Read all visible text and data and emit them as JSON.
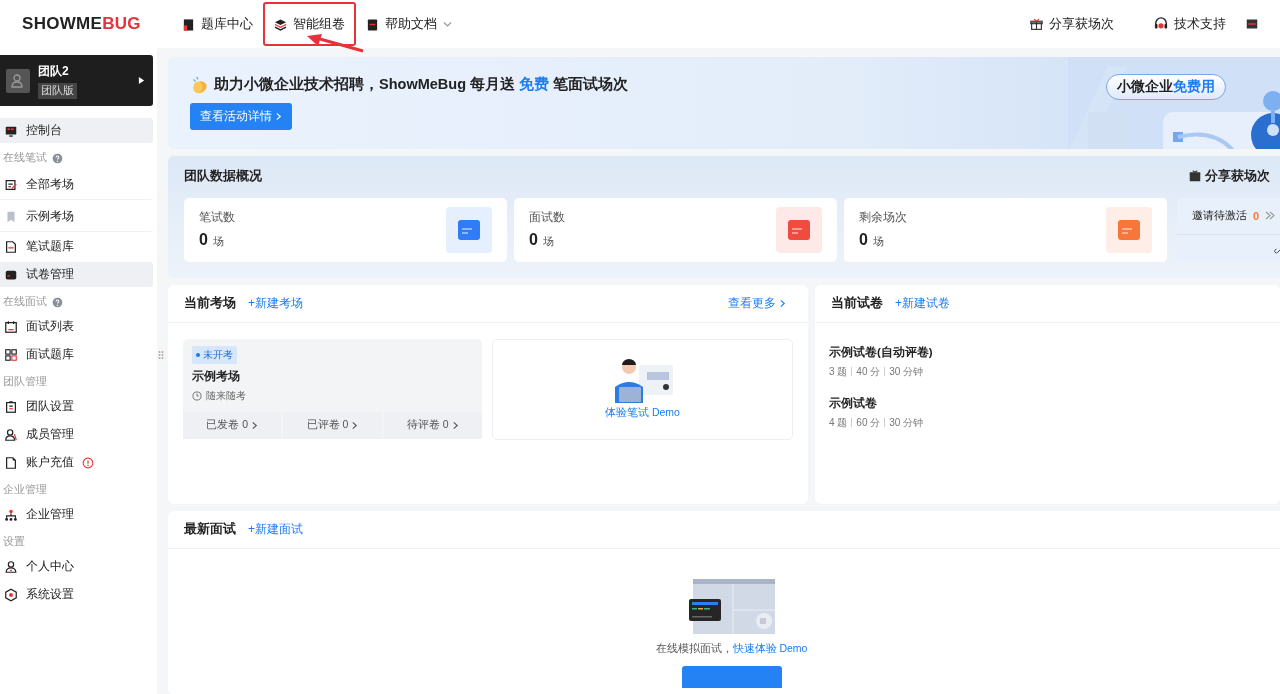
{
  "logo": {
    "parts": [
      "SHOWME",
      "BUG"
    ]
  },
  "nav": [
    {
      "label": "题库中心",
      "dropdown": false,
      "highlight": false
    },
    {
      "label": "智能组卷",
      "dropdown": false,
      "highlight": true
    },
    {
      "label": "帮助文档",
      "dropdown": true,
      "highlight": false
    }
  ],
  "nav_right": [
    {
      "label": "分享获场次"
    },
    {
      "label": "技术支持"
    }
  ],
  "team": {
    "name": "团队2",
    "plan": "团队版"
  },
  "sidebar": [
    {
      "kind": "item",
      "label": "控制台",
      "selected": true
    },
    {
      "kind": "section",
      "label": "在线笔试",
      "help": true
    },
    {
      "kind": "item",
      "label": "全部考场",
      "selected": false,
      "divider": true
    },
    {
      "kind": "item",
      "label": "示例考场",
      "selected": false,
      "divider": true
    },
    {
      "kind": "item",
      "label": "笔试题库",
      "selected": false
    },
    {
      "kind": "item",
      "label": "试卷管理",
      "selected": true
    },
    {
      "kind": "section",
      "label": "在线面试",
      "help": true
    },
    {
      "kind": "item",
      "label": "面试列表",
      "selected": false
    },
    {
      "kind": "item",
      "label": "面试题库",
      "selected": false
    },
    {
      "kind": "section",
      "label": "团队管理",
      "help": false
    },
    {
      "kind": "item",
      "label": "团队设置",
      "selected": false
    },
    {
      "kind": "item",
      "label": "成员管理",
      "selected": false
    },
    {
      "kind": "item",
      "label": "账户充值",
      "selected": false,
      "alert": true
    },
    {
      "kind": "section",
      "label": "企业管理",
      "help": false
    },
    {
      "kind": "item",
      "label": "企业管理",
      "selected": false
    },
    {
      "kind": "section",
      "label": "设置",
      "help": false
    },
    {
      "kind": "item",
      "label": "个人中心",
      "selected": false
    },
    {
      "kind": "item",
      "label": "系统设置",
      "selected": false
    }
  ],
  "banner": {
    "before": "助力小微企业技术招聘，ShowMeBug 每月送 ",
    "highlight": "免费",
    "after": " 笔面试场次",
    "button": "查看活动详情",
    "badge": {
      "text": "小微企业",
      "highlight": "免费用"
    }
  },
  "overview": {
    "title": "团队数据概况",
    "share": "分享获场次",
    "stats": [
      {
        "label": "笔试数",
        "value": "0",
        "unit": "场",
        "color": "#2f7cf6"
      },
      {
        "label": "面试数",
        "value": "0",
        "unit": "场",
        "color": "#ef4b3f"
      },
      {
        "label": "剩余场次",
        "value": "0",
        "unit": "场",
        "color": "#f7773a"
      }
    ],
    "invite": {
      "label": "邀请待激活",
      "count": "0"
    }
  },
  "exams": {
    "title": "当前考场",
    "action": "+新建考场",
    "more": "查看更多",
    "card": {
      "status": "未开考",
      "name": "示例考场",
      "mode": "随来随考",
      "stats": [
        "已发卷 0",
        "已评卷 0",
        "待评卷 0"
      ]
    },
    "demo": "体验笔试 Demo"
  },
  "papers": {
    "title": "当前试卷",
    "action": "+新建试卷",
    "items": [
      {
        "name": "示例试卷(自动评卷)",
        "meta": [
          "3 题",
          "40 分",
          "30 分钟"
        ]
      },
      {
        "name": "示例试卷",
        "meta": [
          "4 题",
          "60 分",
          "30 分钟"
        ]
      }
    ]
  },
  "interviews": {
    "title": "最新面试",
    "action": "+新建面试",
    "empty_text": "在线模拟面试，",
    "empty_link": "快速体验 Demo"
  }
}
